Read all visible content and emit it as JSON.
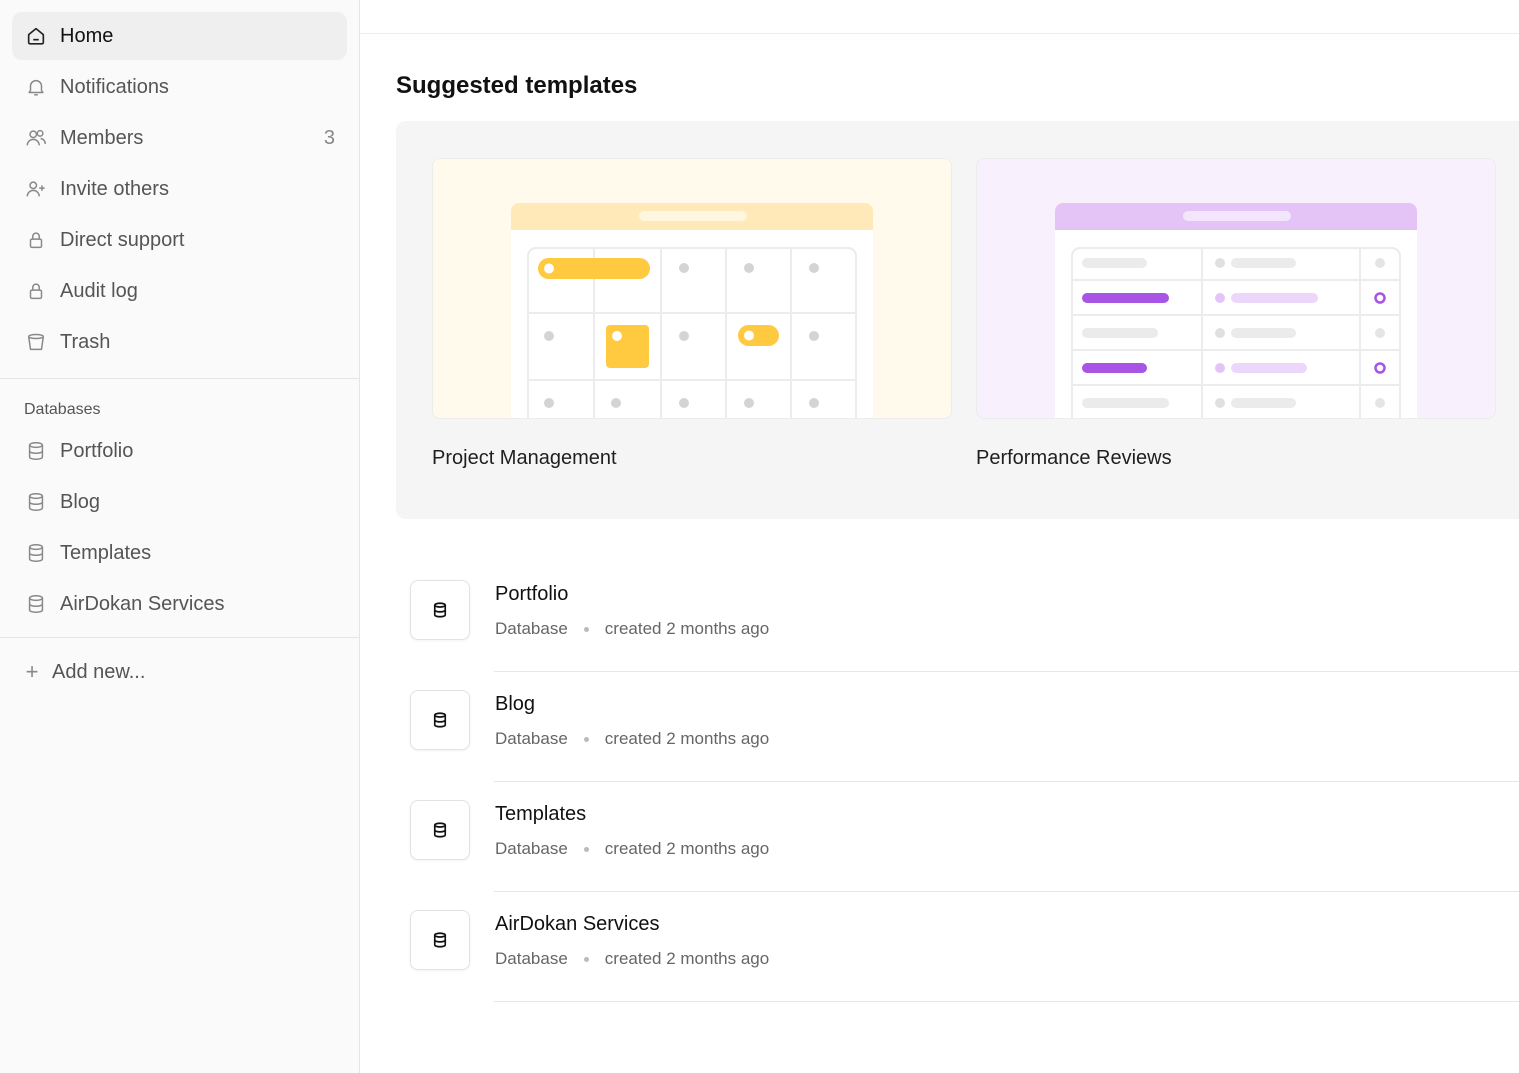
{
  "sidebar": {
    "nav": [
      {
        "label": "Home",
        "icon": "home-icon",
        "active": true
      },
      {
        "label": "Notifications",
        "icon": "bell-icon"
      },
      {
        "label": "Members",
        "icon": "users-icon",
        "count": "3"
      },
      {
        "label": "Invite others",
        "icon": "user-plus-icon"
      },
      {
        "label": "Direct support",
        "icon": "lock-icon"
      },
      {
        "label": "Audit log",
        "icon": "lock-icon"
      },
      {
        "label": "Trash",
        "icon": "trash-icon"
      }
    ],
    "databases_label": "Databases",
    "databases": [
      {
        "label": "Portfolio",
        "icon": "database-icon"
      },
      {
        "label": "Blog",
        "icon": "database-icon"
      },
      {
        "label": "Templates",
        "icon": "database-icon"
      },
      {
        "label": "AirDokan Services",
        "icon": "database-icon"
      }
    ],
    "add_new": "Add new..."
  },
  "main": {
    "suggested_title": "Suggested templates",
    "templates": [
      {
        "name": "Project Management",
        "accent": "#ffc940",
        "bg": "#fffaeb",
        "header": "#ffe9b8"
      },
      {
        "name": "Performance Reviews",
        "accent": "#a855e6",
        "bg": "#f8f1fd",
        "header": "#e4c4f7"
      }
    ],
    "databases": [
      {
        "name": "Portfolio",
        "type": "Database",
        "created": "created 2 months ago"
      },
      {
        "name": "Blog",
        "type": "Database",
        "created": "created 2 months ago"
      },
      {
        "name": "Templates",
        "type": "Database",
        "created": "created 2 months ago"
      },
      {
        "name": "AirDokan Services",
        "type": "Database",
        "created": "created 2 months ago"
      }
    ]
  }
}
